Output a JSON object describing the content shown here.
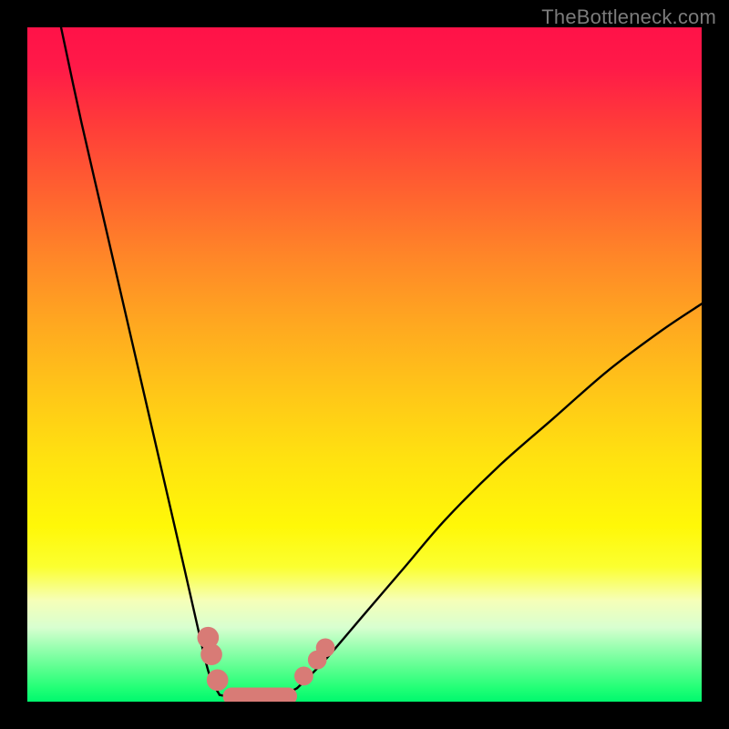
{
  "watermark": "TheBottleneck.com",
  "colors": {
    "background": "#000000",
    "curve": "#000000",
    "marker": "#d87b76",
    "gradient_top": "#ff1248",
    "gradient_bottom": "#00f86e"
  },
  "chart_data": {
    "type": "line",
    "title": "",
    "xlabel": "",
    "ylabel": "",
    "xlim": [
      0,
      100
    ],
    "ylim": [
      0,
      100
    ],
    "axis_ticks": [],
    "annotations": [
      "TheBottleneck.com"
    ],
    "description_note": "Bottleneck-style V curve; color gradient from red (high) to green (low). Minimum (optimal) band roughly x≈28–40 at y≈0–3. Left branch rises to ~100 at x≈5; right branch rises to ~59 at x≈100.",
    "series": [
      {
        "name": "left-branch",
        "x": [
          5,
          8,
          11,
          14,
          17,
          20,
          23,
          25.5,
          27,
          28.5
        ],
        "y": [
          100,
          86,
          73,
          60,
          47,
          34,
          21,
          10,
          4,
          1
        ]
      },
      {
        "name": "right-branch",
        "x": [
          40,
          44,
          50,
          56,
          62,
          70,
          78,
          86,
          94,
          100
        ],
        "y": [
          2,
          6,
          13,
          20,
          27,
          35,
          42,
          49,
          55,
          59
        ]
      },
      {
        "name": "valley-floor",
        "x": [
          28.5,
          31,
          34,
          37,
          40
        ],
        "y": [
          1,
          0.5,
          0.3,
          0.5,
          2
        ]
      }
    ],
    "markers": [
      {
        "x": 26.8,
        "y": 9.5,
        "r": 1.6
      },
      {
        "x": 27.3,
        "y": 7.0,
        "r": 1.6
      },
      {
        "x": 28.2,
        "y": 3.2,
        "r": 1.6
      },
      {
        "x": 41.0,
        "y": 3.8,
        "r": 1.4
      },
      {
        "x": 43.0,
        "y": 6.2,
        "r": 1.4
      },
      {
        "x": 44.2,
        "y": 8.0,
        "r": 1.4
      }
    ],
    "valley_bar": {
      "x0": 29.0,
      "x1": 40.0,
      "y": 0.8,
      "thickness": 2.6
    }
  }
}
